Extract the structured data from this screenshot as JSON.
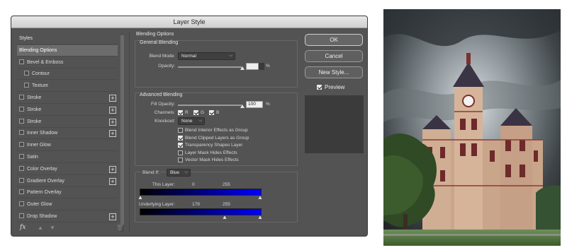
{
  "dialog": {
    "title": "Layer Style"
  },
  "styles_list": [
    {
      "label": "Styles",
      "type": "header",
      "checked": false,
      "add": false,
      "selected": false
    },
    {
      "label": "Blending Options",
      "type": "item",
      "checked": false,
      "add": false,
      "selected": true
    },
    {
      "label": "Bevel & Emboss",
      "type": "check",
      "checked": false,
      "add": false,
      "selected": false
    },
    {
      "label": "Contour",
      "type": "subcheck",
      "checked": false,
      "add": false,
      "selected": false
    },
    {
      "label": "Texture",
      "type": "subcheck",
      "checked": false,
      "add": false,
      "selected": false
    },
    {
      "label": "Stroke",
      "type": "check",
      "checked": false,
      "add": true,
      "selected": false
    },
    {
      "label": "Stroke",
      "type": "check",
      "checked": false,
      "add": true,
      "selected": false
    },
    {
      "label": "Stroke",
      "type": "check",
      "checked": false,
      "add": true,
      "selected": false
    },
    {
      "label": "Inner Shadow",
      "type": "check",
      "checked": false,
      "add": true,
      "selected": false
    },
    {
      "label": "Inner Glow",
      "type": "check",
      "checked": false,
      "add": false,
      "selected": false
    },
    {
      "label": "Satin",
      "type": "check",
      "checked": false,
      "add": false,
      "selected": false
    },
    {
      "label": "Color Overlay",
      "type": "check",
      "checked": false,
      "add": true,
      "selected": false
    },
    {
      "label": "Gradient Overlay",
      "type": "check",
      "checked": false,
      "add": true,
      "selected": false
    },
    {
      "label": "Pattern Overlay",
      "type": "check",
      "checked": false,
      "add": false,
      "selected": false
    },
    {
      "label": "Outer Glow",
      "type": "check",
      "checked": false,
      "add": false,
      "selected": false
    },
    {
      "label": "Drop Shadow",
      "type": "check",
      "checked": false,
      "add": true,
      "selected": false
    }
  ],
  "footer": {
    "fx_label": "fx"
  },
  "blending": {
    "title": "Blending Options",
    "general": {
      "title": "General Blending",
      "blend_mode_label": "Blend Mode:",
      "blend_mode_value": "Normal",
      "opacity_label": "Opacity:",
      "opacity_value": "100",
      "percent": "%"
    },
    "advanced": {
      "title": "Advanced Blending",
      "fill_opacity_label": "Fill Opacity:",
      "fill_opacity_value": "100",
      "percent": "%",
      "channels_label": "Channels:",
      "channel_r": "R",
      "channel_g": "G",
      "channel_b": "B",
      "knockout_label": "Knockout:",
      "knockout_value": "None",
      "options": [
        {
          "label": "Blend Interior Effects as Group",
          "checked": false
        },
        {
          "label": "Blend Clipped Layers as Group",
          "checked": true
        },
        {
          "label": "Transparency Shapes Layer",
          "checked": true
        },
        {
          "label": "Layer Mask Hides Effects",
          "checked": false
        },
        {
          "label": "Vector Mask Hides Effects",
          "checked": false
        }
      ]
    },
    "blend_if": {
      "label": "Blend If:",
      "channel": "Blue",
      "this_layer_label": "This Layer:",
      "this_layer_low": "0",
      "this_layer_high": "255",
      "underlying_label": "Underlying Layer:",
      "underlying_low": "179",
      "underlying_high": "255"
    }
  },
  "buttons": {
    "ok": "OK",
    "cancel": "Cancel",
    "new_style": "New Style...",
    "preview": "Preview",
    "preview_checked": true
  }
}
